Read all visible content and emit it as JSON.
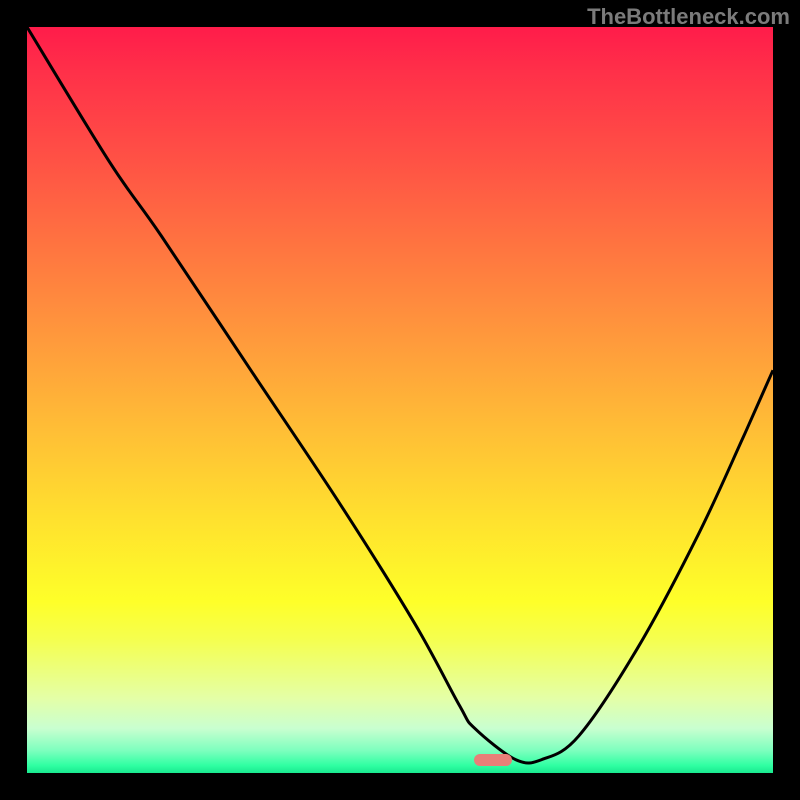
{
  "watermark": "TheBottleneck.com",
  "marker": {
    "cx_frac": 0.625,
    "cy_frac": 0.982
  },
  "chart_data": {
    "type": "line",
    "title": "",
    "xlabel": "",
    "ylabel": "",
    "xlim": [
      0,
      1
    ],
    "ylim": [
      0,
      1
    ],
    "series": [
      {
        "name": "curve",
        "x": [
          0.0,
          0.11,
          0.18,
          0.3,
          0.42,
          0.52,
          0.58,
          0.6,
          0.655,
          0.69,
          0.74,
          0.82,
          0.9,
          0.96,
          1.0
        ],
        "y": [
          1.0,
          0.82,
          0.72,
          0.54,
          0.36,
          0.2,
          0.09,
          0.06,
          0.018,
          0.018,
          0.05,
          0.17,
          0.32,
          0.45,
          0.54
        ]
      }
    ],
    "annotations": [
      {
        "type": "marker",
        "x": 0.625,
        "y": 0.018
      }
    ]
  }
}
